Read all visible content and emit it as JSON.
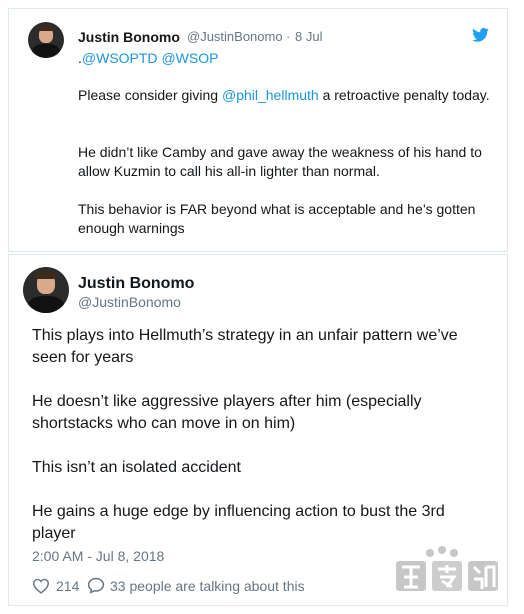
{
  "quoted_tweet": {
    "author_name": "Justin Bonomo",
    "author_handle": "@JustinBonomo",
    "separator": "·",
    "date": "8 Jul",
    "mention_prefix": ".",
    "mentions": [
      "@WSOPTD",
      "@WSOP"
    ],
    "p1_before": "Please consider giving ",
    "p1_link": "@phil_hellmuth",
    "p1_after": " a retroactive penalty today.",
    "p2": "He didn’t like Camby and gave away the weakness of his hand to allow Kuzmin to call his all-in lighter than normal.",
    "p3": "This behavior is FAR beyond what is acceptable and he’s gotten enough warnings"
  },
  "main_tweet": {
    "author_name": "Justin Bonomo",
    "author_handle": "@JustinBonomo",
    "p1": "This plays into Hellmuth’s strategy in an unfair pattern we’ve seen for years",
    "p2": "He doesn’t like aggressive players after him (especially shortstacks who can move in on him)",
    "p3": "This isn’t an isolated accident",
    "p4": "He gains a huge edge by influencing action to bust the 3rd player",
    "timestamp": "2:00 AM - Jul 8, 2018",
    "likes": "214",
    "talking": "33 people are talking about this"
  },
  "icons": {
    "twitter": "twitter-bird-icon",
    "heart": "heart-icon",
    "reply": "speech-bubble-icon"
  },
  "colors": {
    "link": "#1b95e0",
    "text": "#14171a",
    "muted": "#657786",
    "border": "#e1e8ed"
  }
}
